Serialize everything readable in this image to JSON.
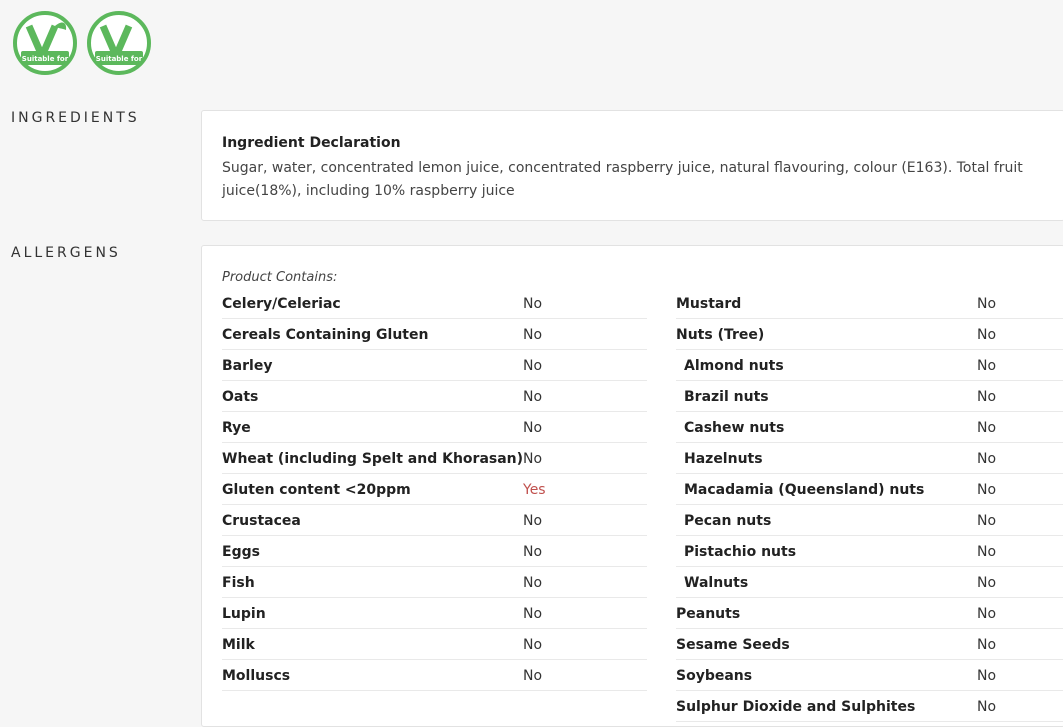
{
  "badges": [
    {
      "name": "vegetarian-badge",
      "label": "Suitable for",
      "color": "#5cb85c"
    },
    {
      "name": "vegan-badge",
      "label": "Suitable for",
      "color": "#5cb85c"
    }
  ],
  "ingredients": {
    "section_title": "INGREDIENTS",
    "heading": "Ingredient Declaration",
    "text": "Sugar, water, concentrated lemon juice, concentrated raspberry juice, natural flavouring, colour (E163). Total fruit juice(18%), including 10% raspberry juice"
  },
  "allergens": {
    "section_title": "ALLERGENS",
    "contains_label": "Product Contains:",
    "left": [
      {
        "name": "Celery/Celeriac",
        "value": "No"
      },
      {
        "name": "Cereals Containing Gluten",
        "value": "No"
      },
      {
        "name": "Barley",
        "value": "No"
      },
      {
        "name": "Oats",
        "value": "No"
      },
      {
        "name": "Rye",
        "value": "No"
      },
      {
        "name": "Wheat (including Spelt and Khorasan)",
        "value": "No"
      },
      {
        "name": "Gluten content <20ppm",
        "value": "Yes"
      },
      {
        "name": "Crustacea",
        "value": "No"
      },
      {
        "name": "Eggs",
        "value": "No"
      },
      {
        "name": "Fish",
        "value": "No"
      },
      {
        "name": "Lupin",
        "value": "No"
      },
      {
        "name": "Milk",
        "value": "No"
      },
      {
        "name": "Molluscs",
        "value": "No"
      }
    ],
    "right": [
      {
        "name": "Mustard",
        "value": "No",
        "sub": false
      },
      {
        "name": "Nuts (Tree)",
        "value": "No",
        "sub": false
      },
      {
        "name": "Almond nuts",
        "value": "No",
        "sub": true
      },
      {
        "name": "Brazil nuts",
        "value": "No",
        "sub": true
      },
      {
        "name": "Cashew nuts",
        "value": "No",
        "sub": true
      },
      {
        "name": "Hazelnuts",
        "value": "No",
        "sub": true
      },
      {
        "name": "Macadamia (Queensland) nuts",
        "value": "No",
        "sub": true
      },
      {
        "name": "Pecan nuts",
        "value": "No",
        "sub": true
      },
      {
        "name": "Pistachio nuts",
        "value": "No",
        "sub": true
      },
      {
        "name": "Walnuts",
        "value": "No",
        "sub": true
      },
      {
        "name": "Peanuts",
        "value": "No",
        "sub": false
      },
      {
        "name": "Sesame Seeds",
        "value": "No",
        "sub": false
      },
      {
        "name": "Soybeans",
        "value": "No",
        "sub": false
      },
      {
        "name": "Sulphur Dioxide and Sulphites",
        "value": "No",
        "sub": false
      }
    ]
  }
}
